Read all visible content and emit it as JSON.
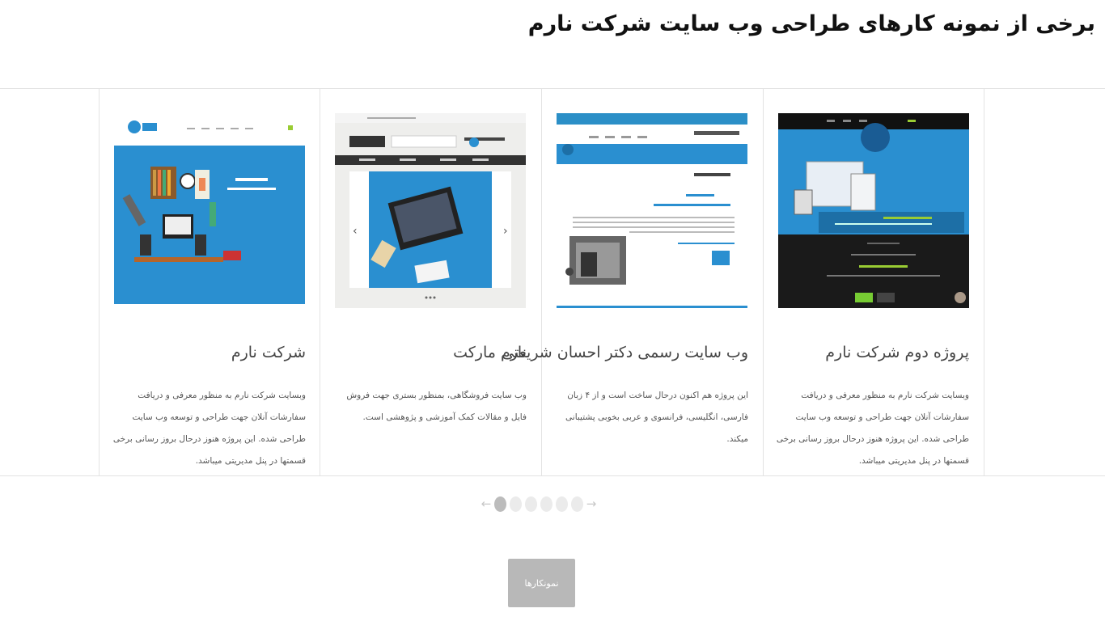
{
  "page": {
    "heading": "برخی از نمونه کارهای طراحی وب سایت شرکت نارم",
    "button_label": "نمونکارها"
  },
  "colors": {
    "accent_blue": "#2a8fd0",
    "dot_active": "#bcbcbc",
    "dot_inactive": "#ebebeb",
    "button_bg": "#b8b8b8"
  },
  "cards": [
    {
      "title": "پروژه دوم شرکت نارم",
      "desc": "وبسایت شرکت نارم به منظور معرفی و دریافت سفارشات آنلان جهت طراحی و توسعه وب سایت طراحی شده. این پروژه هنوز درحال بروز رسانی برخی قسمتها در پنل مدیریتی میباشد."
    },
    {
      "title": "وب سایت رسمی دکتر احسان شریعتی",
      "desc": "این پروژه هم اکنون درحال ساخت است و از ۴ زبان فارسی، انگلیسی، فرانسوی و عربی بخوبی پشتیبانی میکند."
    },
    {
      "title": "نارم مارکت",
      "desc": "وب سایت فروشگاهی، بمنظور بستری جهت فروش فایل و مقالات کمک آموزشی و پژوهشی است."
    },
    {
      "title": "شرکت نارم",
      "desc": "وبسایت شرکت نارم به منظور معرفی و دریافت سفارشات آنلان جهت طراحی و توسعه وب سایت طراحی شده. این پروژه هنوز درحال بروز رسانی برخی قسمتها در پنل مدیریتی میباشد."
    }
  ],
  "pagination": {
    "pages": 6,
    "active_index": 0,
    "prev_icon": "arrow-left-icon",
    "next_icon": "arrow-right-icon"
  }
}
